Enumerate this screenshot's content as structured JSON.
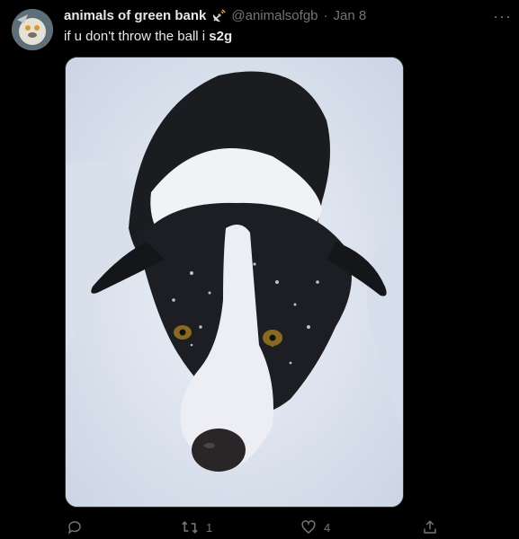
{
  "tweet": {
    "display_name": "animals of green bank",
    "handle": "@animalsofgb",
    "separator": "·",
    "date": "Jan 8",
    "text_main": "if u don't throw the ball i ",
    "text_bold": "s2g",
    "more_label": "···"
  },
  "actions": {
    "reply_count": "",
    "retweet_count": "1",
    "like_count": "4"
  },
  "icons": {
    "badge": "satellite-dish-icon",
    "reply": "reply-icon",
    "retweet": "retweet-icon",
    "like": "heart-icon",
    "share": "share-icon"
  },
  "colors": {
    "background": "#000000",
    "text": "#e7e9ea",
    "muted": "#71767b"
  }
}
